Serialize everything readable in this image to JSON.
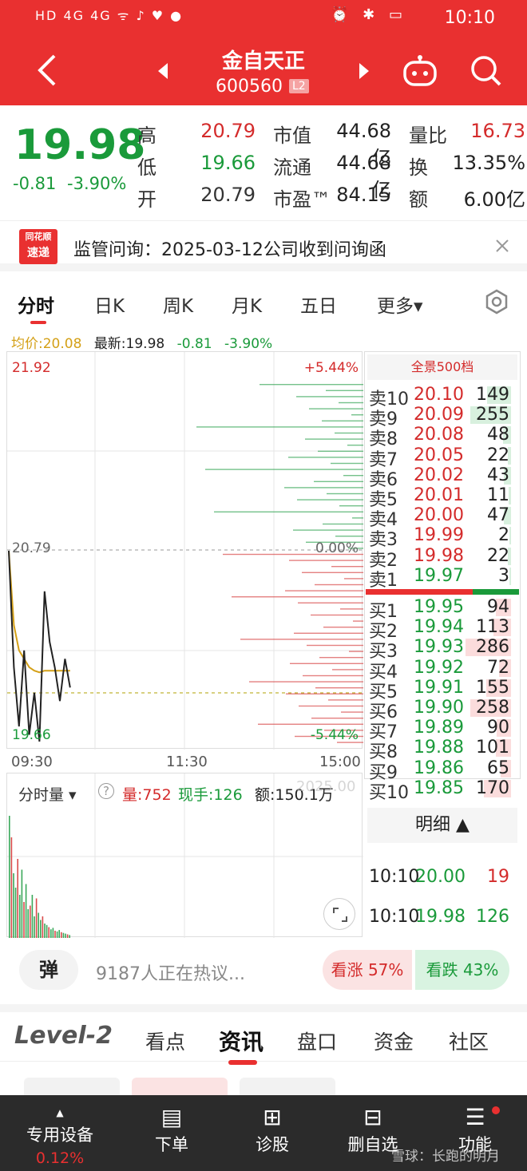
{
  "status_bar": {
    "left_icons": "HD 4G 4G ᯤ ♪ ♥ ●",
    "right_icons": "⏰ ✱ ▭",
    "time": "10:10"
  },
  "header": {
    "title": "金自天正",
    "code": "600560",
    "level_badge": "L2"
  },
  "quote": {
    "price": "19.98",
    "change": "-0.81",
    "change_pct": "-3.90%",
    "high_label": "高",
    "high": "20.79",
    "low_label": "低",
    "low": "19.66",
    "open_label": "开",
    "open": "20.79",
    "mcap_label": "市值",
    "mcap": "44.68亿",
    "float_label": "流通",
    "float": "44.68亿",
    "pe_label": "市盈™",
    "pe": "84.15",
    "vr_label": "量比",
    "vr": "16.73",
    "turn_label": "换",
    "turn": "13.35%",
    "amt_label": "额",
    "amt": "6.00亿"
  },
  "notice": {
    "badge_top": "同花顺",
    "badge_bottom": "速递",
    "text": "监管问询：2025-03-12公司收到问询函"
  },
  "chart_tabs": [
    "分时",
    "日K",
    "周K",
    "月K",
    "五日",
    "更多▾"
  ],
  "legend": {
    "avg": "均价:20.08",
    "latest": "最新:19.98",
    "chg": "-0.81",
    "pct": "-3.90%"
  },
  "chart_axis": {
    "top_price": "21.92",
    "mid_price": "20.79",
    "low_price": "19.66",
    "top_pct": "+5.44%",
    "mid_pct": "0.00%",
    "low_pct": "-5.44%",
    "t_start": "09:30",
    "t_mid": "11:30",
    "t_end": "15:00"
  },
  "chart_data": {
    "type": "line",
    "x": [
      "09:30",
      "09:31",
      "09:32",
      "09:33",
      "09:34",
      "09:35",
      "09:36",
      "09:37",
      "09:38",
      "09:39",
      "09:40",
      "09:41",
      "09:42"
    ],
    "series": [
      {
        "values": [
          20.79,
          20.1,
          19.75,
          20.2,
          19.7,
          19.95,
          19.66,
          20.55,
          20.25,
          20.1,
          19.9,
          20.15,
          19.98
        ]
      },
      {
        "values": [
          20.79,
          20.35,
          20.2,
          20.15,
          20.1,
          20.08,
          20.07,
          20.08,
          20.08,
          20.08,
          20.08,
          20.08,
          20.08
        ]
      }
    ],
    "ylim": [
      19.66,
      21.92
    ]
  },
  "volume": {
    "selector": "分时量 ▾",
    "help": "?",
    "vol": "量:752",
    "hand": "现手:126",
    "amt": "额:150.1万",
    "overlay": "2025.00"
  },
  "book": {
    "title": "全景500档",
    "asks": [
      {
        "label": "卖10",
        "price": "20.10",
        "vol": "149",
        "w": 0.2
      },
      {
        "label": "卖9",
        "price": "20.09",
        "vol": "255",
        "w": 0.34
      },
      {
        "label": "卖8",
        "price": "20.08",
        "vol": "48",
        "w": 0.07
      },
      {
        "label": "卖7",
        "price": "20.05",
        "vol": "22",
        "w": 0.03
      },
      {
        "label": "卖6",
        "price": "20.02",
        "vol": "43",
        "w": 0.06
      },
      {
        "label": "卖5",
        "price": "20.01",
        "vol": "11",
        "w": 0.02
      },
      {
        "label": "卖4",
        "price": "20.00",
        "vol": "47",
        "w": 0.06
      },
      {
        "label": "卖3",
        "price": "19.99",
        "vol": "2",
        "w": 0.01
      },
      {
        "label": "卖2",
        "price": "19.98",
        "vol": "22",
        "w": 0.03
      },
      {
        "label": "卖1",
        "price": "19.97",
        "vol": "3",
        "w": 0.01
      }
    ],
    "bids": [
      {
        "label": "买1",
        "price": "19.95",
        "vol": "94",
        "w": 0.13
      },
      {
        "label": "买2",
        "price": "19.94",
        "vol": "113",
        "w": 0.15
      },
      {
        "label": "买3",
        "price": "19.93",
        "vol": "286",
        "w": 0.38
      },
      {
        "label": "买4",
        "price": "19.92",
        "vol": "72",
        "w": 0.1
      },
      {
        "label": "买5",
        "price": "19.91",
        "vol": "155",
        "w": 0.21
      },
      {
        "label": "买6",
        "price": "19.90",
        "vol": "258",
        "w": 0.34
      },
      {
        "label": "买7",
        "price": "19.89",
        "vol": "90",
        "w": 0.12
      },
      {
        "label": "买8",
        "price": "19.88",
        "vol": "101",
        "w": 0.13
      },
      {
        "label": "买9",
        "price": "19.86",
        "vol": "65",
        "w": 0.09
      },
      {
        "label": "买10",
        "price": "19.85",
        "vol": "170",
        "w": 0.23
      }
    ],
    "detail_title": "明细 ▲",
    "ticks": [
      {
        "time": "10:10",
        "price": "20.00",
        "vol": "19"
      },
      {
        "time": "10:10",
        "price": "19.98",
        "vol": "126"
      }
    ]
  },
  "comments": {
    "danmu": "弹",
    "text": "9187人正在热议...",
    "up": "看涨 57%",
    "down": "看跌 43%"
  },
  "sec_tabs": [
    "Level-2",
    "看点",
    "资讯",
    "盘口",
    "资金",
    "社区"
  ],
  "bottom_nav": [
    {
      "label": "专用设备",
      "sub": "0.12%",
      "icon": "▲"
    },
    {
      "label": "下单",
      "icon": "▤"
    },
    {
      "label": "诊股",
      "icon": "⊞"
    },
    {
      "label": "删自选",
      "icon": "⊟"
    },
    {
      "label": "功能",
      "icon": "☰"
    }
  ],
  "watermark": "雪球：长跑的明月",
  "colors": {
    "brand_red": "#e93030",
    "up": "#d42b2b",
    "down": "#1a9a3a"
  }
}
